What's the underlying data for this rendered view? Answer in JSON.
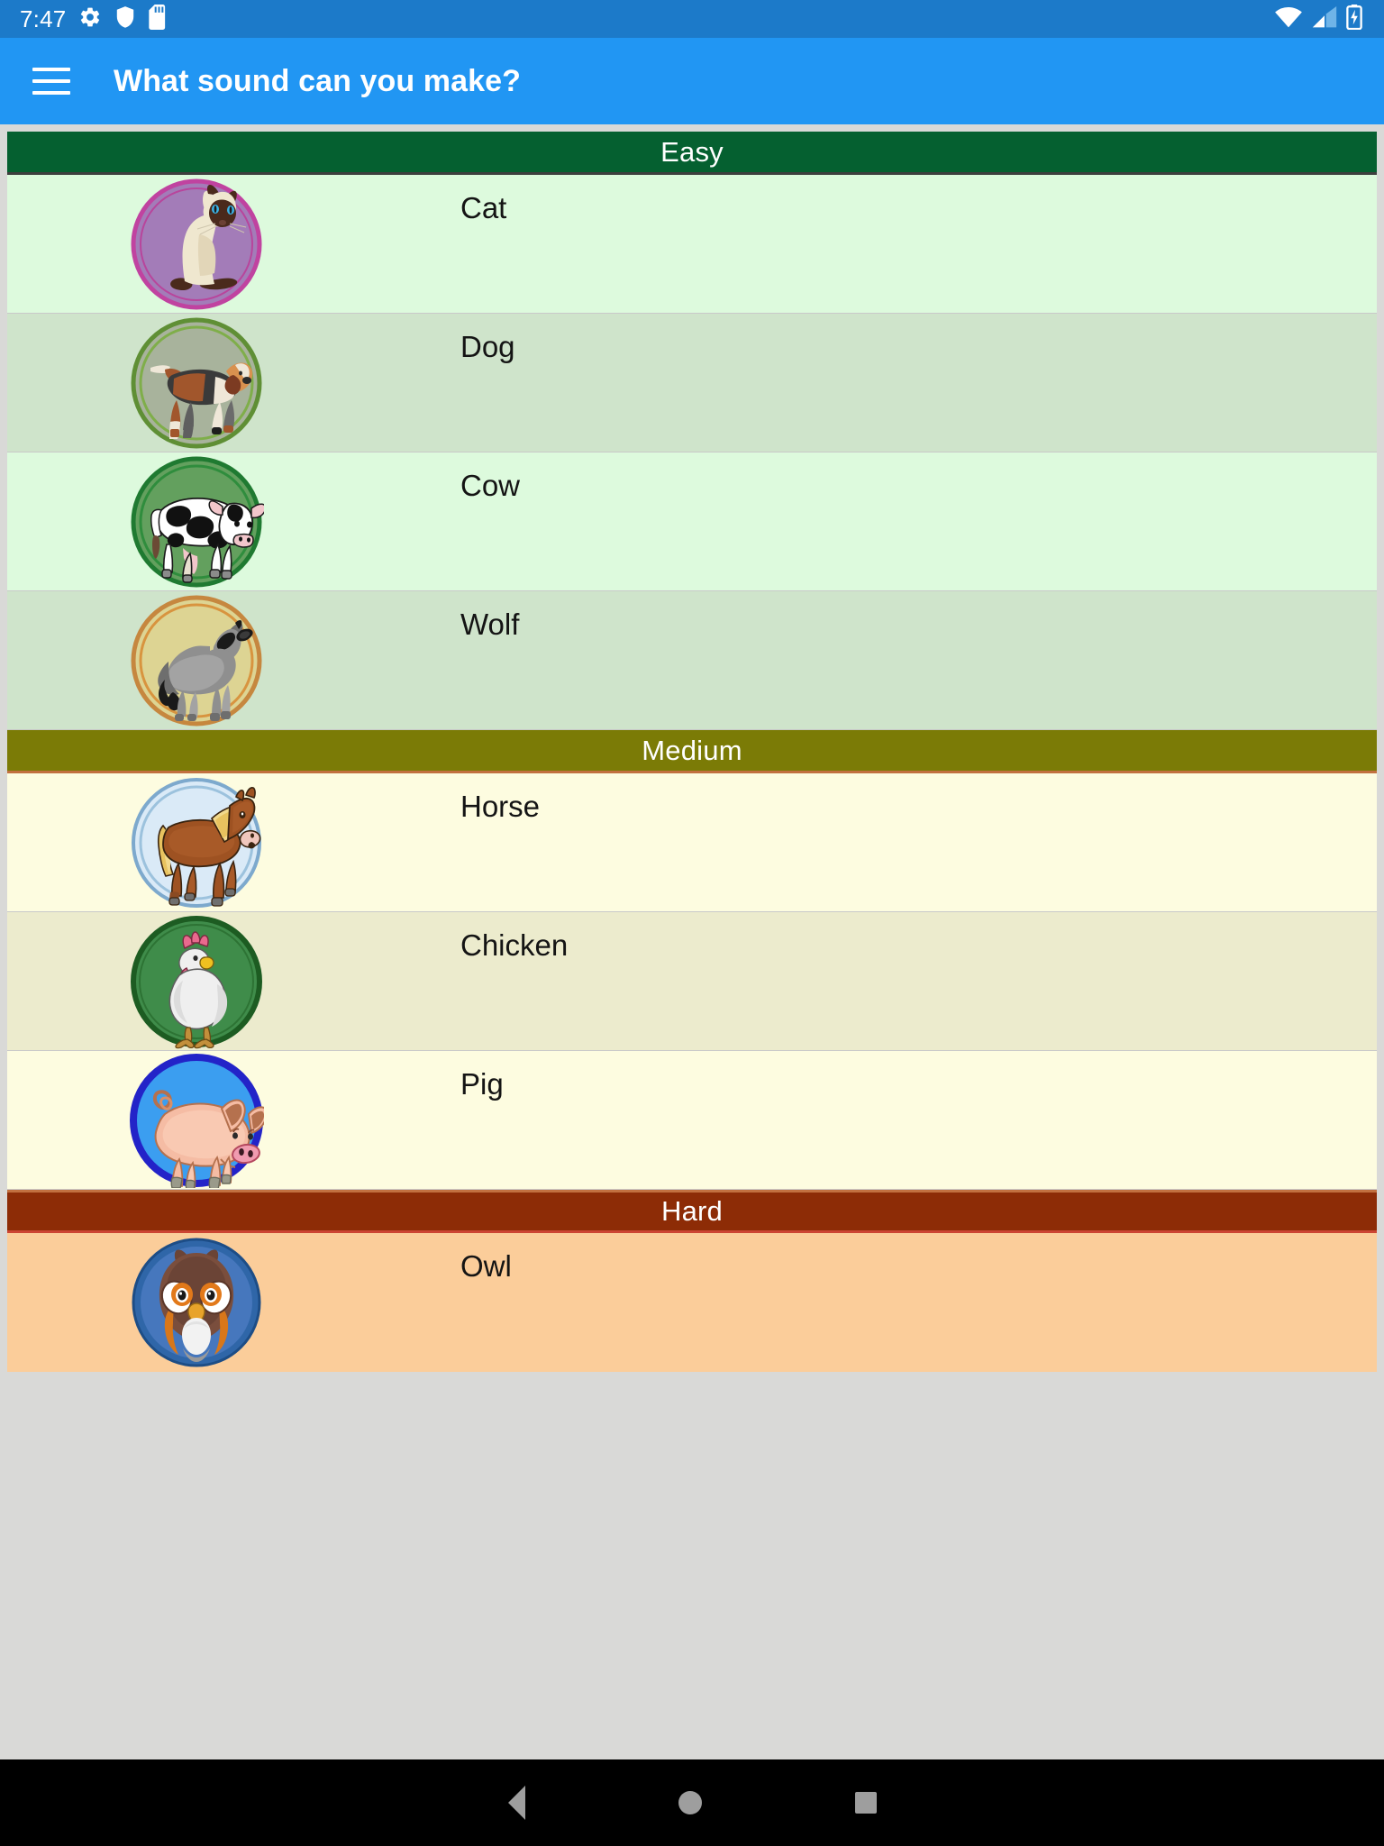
{
  "statusbar": {
    "clock": "7:47",
    "left_icons": [
      "gear-icon",
      "shield-icon",
      "sd-card-icon"
    ],
    "right_icons": [
      "wifi-icon",
      "cellular-signal-icon",
      "battery-charging-icon"
    ]
  },
  "appbar": {
    "menu_icon": "hamburger-menu-icon",
    "title": "What sound can you make?"
  },
  "accent_colors": {
    "appbar": "#2196f3",
    "statusbar": "#1c7ac9",
    "easy_header": "#056030",
    "medium_header": "#7b7b06",
    "hard_header": "#8d2c06",
    "page_background": "#d9d9d7"
  },
  "sections": [
    {
      "id": "easy",
      "title": "Easy",
      "items": [
        {
          "name": "Cat",
          "icon": "cat-avatar"
        },
        {
          "name": "Dog",
          "icon": "dog-avatar"
        },
        {
          "name": "Cow",
          "icon": "cow-avatar"
        },
        {
          "name": "Wolf",
          "icon": "wolf-avatar"
        }
      ]
    },
    {
      "id": "medium",
      "title": "Medium",
      "items": [
        {
          "name": "Horse",
          "icon": "horse-avatar"
        },
        {
          "name": "Chicken",
          "icon": "chicken-avatar"
        },
        {
          "name": "Pig",
          "icon": "pig-avatar"
        }
      ]
    },
    {
      "id": "hard",
      "title": "Hard",
      "items": [
        {
          "name": "Owl",
          "icon": "owl-avatar"
        }
      ]
    }
  ],
  "navbar": {
    "back_label": "Back",
    "home_label": "Home",
    "recents_label": "Recents"
  }
}
